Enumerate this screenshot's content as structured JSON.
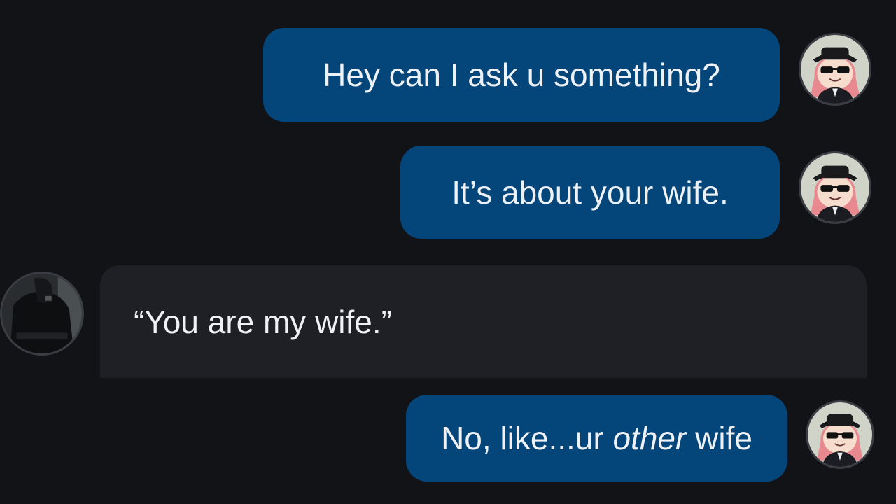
{
  "messages": [
    {
      "id": 1,
      "sender": "me",
      "text": "Hey can I ask u something?"
    },
    {
      "id": 2,
      "sender": "me",
      "text": "It’s about your wife."
    },
    {
      "id": 3,
      "sender": "other",
      "text": "“You are my wife.”"
    },
    {
      "id": 4,
      "sender": "me",
      "text_before": "No, like...ur ",
      "text_emphasis": "other",
      "text_after": " wife"
    }
  ],
  "avatars": {
    "me": "anime-girl-sunglasses-avatar",
    "other": "man-in-black-avatar"
  },
  "colors": {
    "background": "#121317",
    "outgoing_bubble": "#04457a",
    "incoming_bubble": "#1e2025",
    "text": "#eef1f5"
  }
}
